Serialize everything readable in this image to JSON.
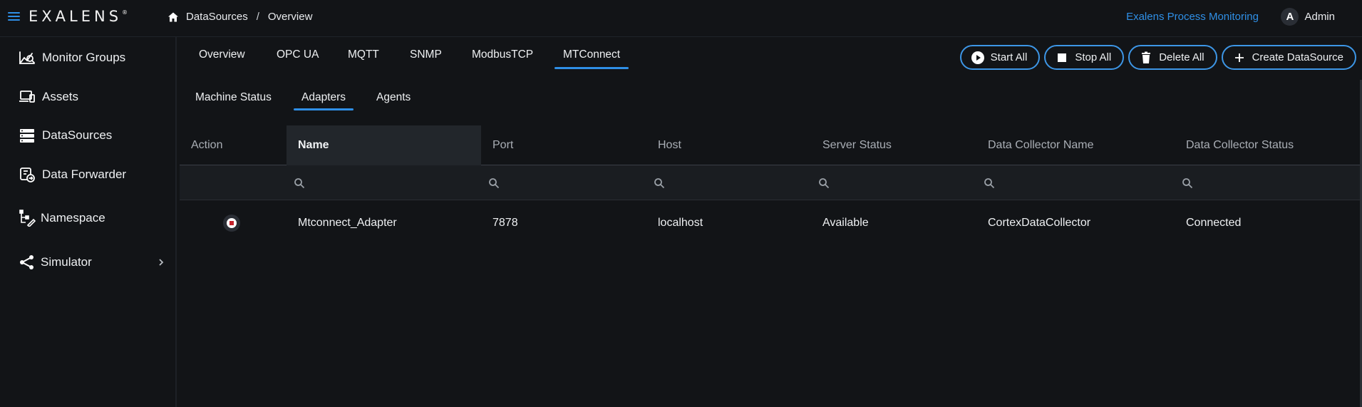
{
  "header": {
    "logo": "EXALENS",
    "logo_mark": "®",
    "breadcrumb": [
      "DataSources",
      "Overview"
    ],
    "breadcrumb_sep": "/",
    "app_name": "Exalens Process Monitoring",
    "user": {
      "initial": "A",
      "name": "Admin"
    }
  },
  "sidebar": {
    "items": [
      {
        "label": "Monitor Groups",
        "icon": "monitor-groups-icon"
      },
      {
        "label": "Assets",
        "icon": "assets-icon"
      },
      {
        "label": "DataSources",
        "icon": "datasources-icon"
      },
      {
        "label": "Data Forwarder",
        "icon": "data-forwarder-icon"
      },
      {
        "label": "Namespace",
        "icon": "namespace-icon"
      },
      {
        "label": "Simulator",
        "icon": "simulator-icon"
      }
    ]
  },
  "tabs": {
    "primary": [
      "Overview",
      "OPC UA",
      "MQTT",
      "SNMP",
      "ModbusTCP",
      "MTConnect"
    ],
    "primary_active": "MTConnect",
    "secondary": [
      "Machine Status",
      "Adapters",
      "Agents"
    ],
    "secondary_active": "Adapters"
  },
  "actions": {
    "start_all": "Start All",
    "stop_all": "Stop All",
    "delete_all": "Delete All",
    "create": "Create DataSource"
  },
  "table": {
    "columns": [
      "Action",
      "Name",
      "Port",
      "Host",
      "Server Status",
      "Data Collector Name",
      "Data Collector Status"
    ],
    "rows": [
      {
        "name": "Mtconnect_Adapter",
        "port": "7878",
        "host": "localhost",
        "server_status": "Available",
        "collector_name": "CortexDataCollector",
        "collector_status": "Connected"
      }
    ]
  },
  "colors": {
    "accent": "#2f8fe6",
    "background": "#121417",
    "stop_red": "#c4232c"
  }
}
